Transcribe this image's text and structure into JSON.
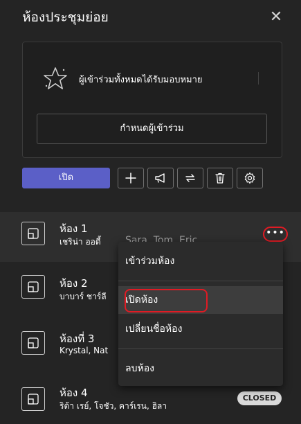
{
  "panel": {
    "title": "ห้องประชุมย่อย",
    "close_glyph": "✕"
  },
  "assign": {
    "message": "ผู้เข้าร่วมทั้งหมดได้รับมอบหมาย",
    "button_label": "กำหนดผู้เข้าร่วม"
  },
  "toolbar": {
    "open_label": "เปิด",
    "icons": [
      "plus-icon",
      "megaphone-icon",
      "recreate-icon",
      "trash-icon",
      "gear-icon"
    ]
  },
  "rooms": [
    {
      "name": "ห้อง 1",
      "participants": "เชริน่า ออดี้",
      "extra": "Sara, Tom, Eric"
    },
    {
      "name": "ห้อง 2",
      "participants": "บาบาร์ ชาร์ลี"
    },
    {
      "name": "ห้องที่ 3",
      "participants": "Krystal, Nat"
    },
    {
      "name": "ห้อง 4",
      "participants": "ริต้า เรย์, โจชัว, คาร์เรน, ฮิลา",
      "status": "CLOSED"
    }
  ],
  "context_menu": {
    "more_glyph": "•••",
    "items": [
      "เข้าร่วมห้อง",
      "เปิดห้อง",
      "เปลี่ยนชื่อห้อง",
      "ลบห้อง"
    ]
  },
  "colors": {
    "background": "#242424",
    "accent": "#5b5fc7",
    "highlight": "#e01b24"
  }
}
